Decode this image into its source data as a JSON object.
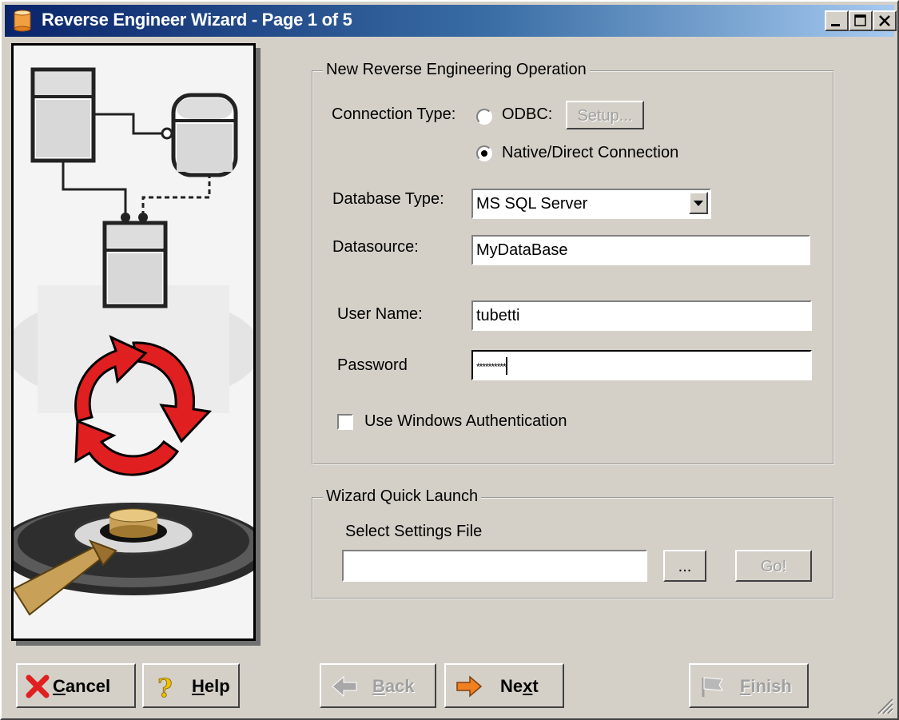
{
  "window": {
    "title": "Reverse Engineer Wizard - Page 1 of 5"
  },
  "operation_group": {
    "legend": "New Reverse Engineering Operation",
    "connection_type_label": "Connection Type:",
    "odbc_label": "ODBC:",
    "setup_button": "Setup...",
    "native_label": "Native/Direct Connection",
    "selected_connection": "Native/Direct Connection",
    "database_type_label": "Database Type:",
    "database_type_value": "MS SQL Server",
    "datasource_label": "Datasource:",
    "datasource_value": "MyDataBase",
    "username_label": "User Name:",
    "username_value": "tubetti",
    "password_label": "Password",
    "password_value": "**********",
    "windows_auth_label": "Use Windows Authentication",
    "windows_auth_checked": false
  },
  "quick_launch_group": {
    "legend": "Wizard Quick Launch",
    "settings_label": "Select Settings File",
    "settings_value": "",
    "browse_button": "...",
    "go_button": "Go!"
  },
  "buttons": {
    "cancel": {
      "hotkey": "C",
      "rest": "ancel"
    },
    "help": {
      "hotkey": "H",
      "rest": "elp"
    },
    "back": {
      "hotkey": "B",
      "rest": "ack"
    },
    "next": {
      "pre": "Ne",
      "hotkey": "x",
      "rest": "t"
    },
    "finish": {
      "hotkey": "F",
      "rest": "inish"
    }
  },
  "colors": {
    "titlebar_start": "#0a246a",
    "titlebar_end": "#a6caf0",
    "face": "#d4d0c8",
    "accent_red": "#e02020",
    "next_arrow": "#f08020"
  }
}
